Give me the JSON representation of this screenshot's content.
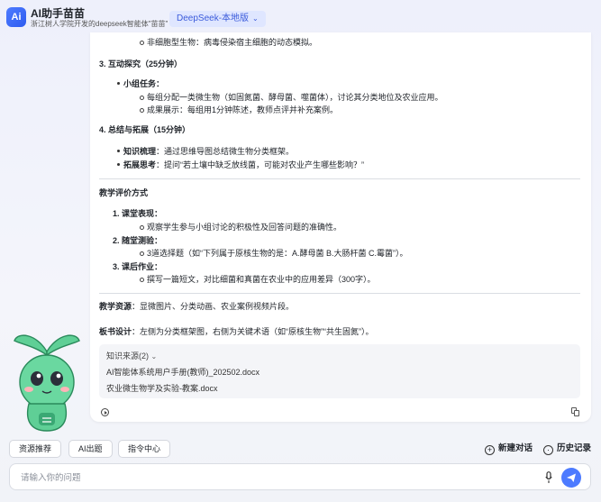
{
  "header": {
    "logo_text": "Ai",
    "title": "AI助手苗苗",
    "subtitle": "浙江树人学院开发的deepseek智能体\"苗苗\"",
    "model": "DeepSeek-本地版"
  },
  "content": {
    "top_item": "非细胞型生物：病毒侵染宿主细胞的动态模拟。",
    "s3_title": "3. 互动探究（25分钟）",
    "s3_bul": "小组任务：",
    "s3_c1": "每组分配一类微生物（如固氮菌、酵母菌、噬菌体），讨论其分类地位及农业应用。",
    "s3_c2": "成果展示：每组用1分钟陈述，教师点评并补充案例。",
    "s4_title": "4. 总结与拓展（15分钟）",
    "s4_b1_label": "知识梳理",
    "s4_b1_text": "：通过思维导图总结微生物分类框架。",
    "s4_b2_label": "拓展思考",
    "s4_b2_text": "：提问“若土壤中缺乏放线菌，可能对农业产生哪些影响？”",
    "eval_title": "教学评价方式",
    "e1": "1. 课堂表现：",
    "e1c": "观察学生参与小组讨论的积极性及回答问题的准确性。",
    "e2": "2. 随堂测验：",
    "e2c": "3道选择题（如“下列属于原核生物的是：A.酵母菌 B.大肠杆菌 C.霉菌”）。",
    "e3": "3. 课后作业：",
    "e3c": "撰写一篇短文，对比细菌和真菌在农业中的应用差异（300字）。",
    "res_label": "教学资源",
    "res_text": "：显微图片、分类动画、农业案例视频片段。",
    "board_label": "板书设计",
    "board_text": "：左侧为分类框架图，右侧为关键术语（如“原核生物”“共生固氮”）。"
  },
  "sources": {
    "title": "知识来源(2)",
    "items": [
      "AI智能体系统用户手册(教师)_202502.docx",
      "农业微生物学及实验-教案.docx"
    ]
  },
  "toolbar": {
    "chip1": "资源推荐",
    "chip2": "AI出题",
    "chip3": "指令中心",
    "new_chat": "新建对话",
    "history": "历史记录"
  },
  "input": {
    "placeholder": "请输入你的问题"
  },
  "colors": {
    "accent": "#4d7bff",
    "mascot_green": "#5fcf96"
  },
  "icons": [
    "logo-icon",
    "chevron-down-icon",
    "play-icon",
    "copy-icon",
    "plus-circle-icon",
    "history-icon",
    "mic-icon",
    "send-icon"
  ]
}
